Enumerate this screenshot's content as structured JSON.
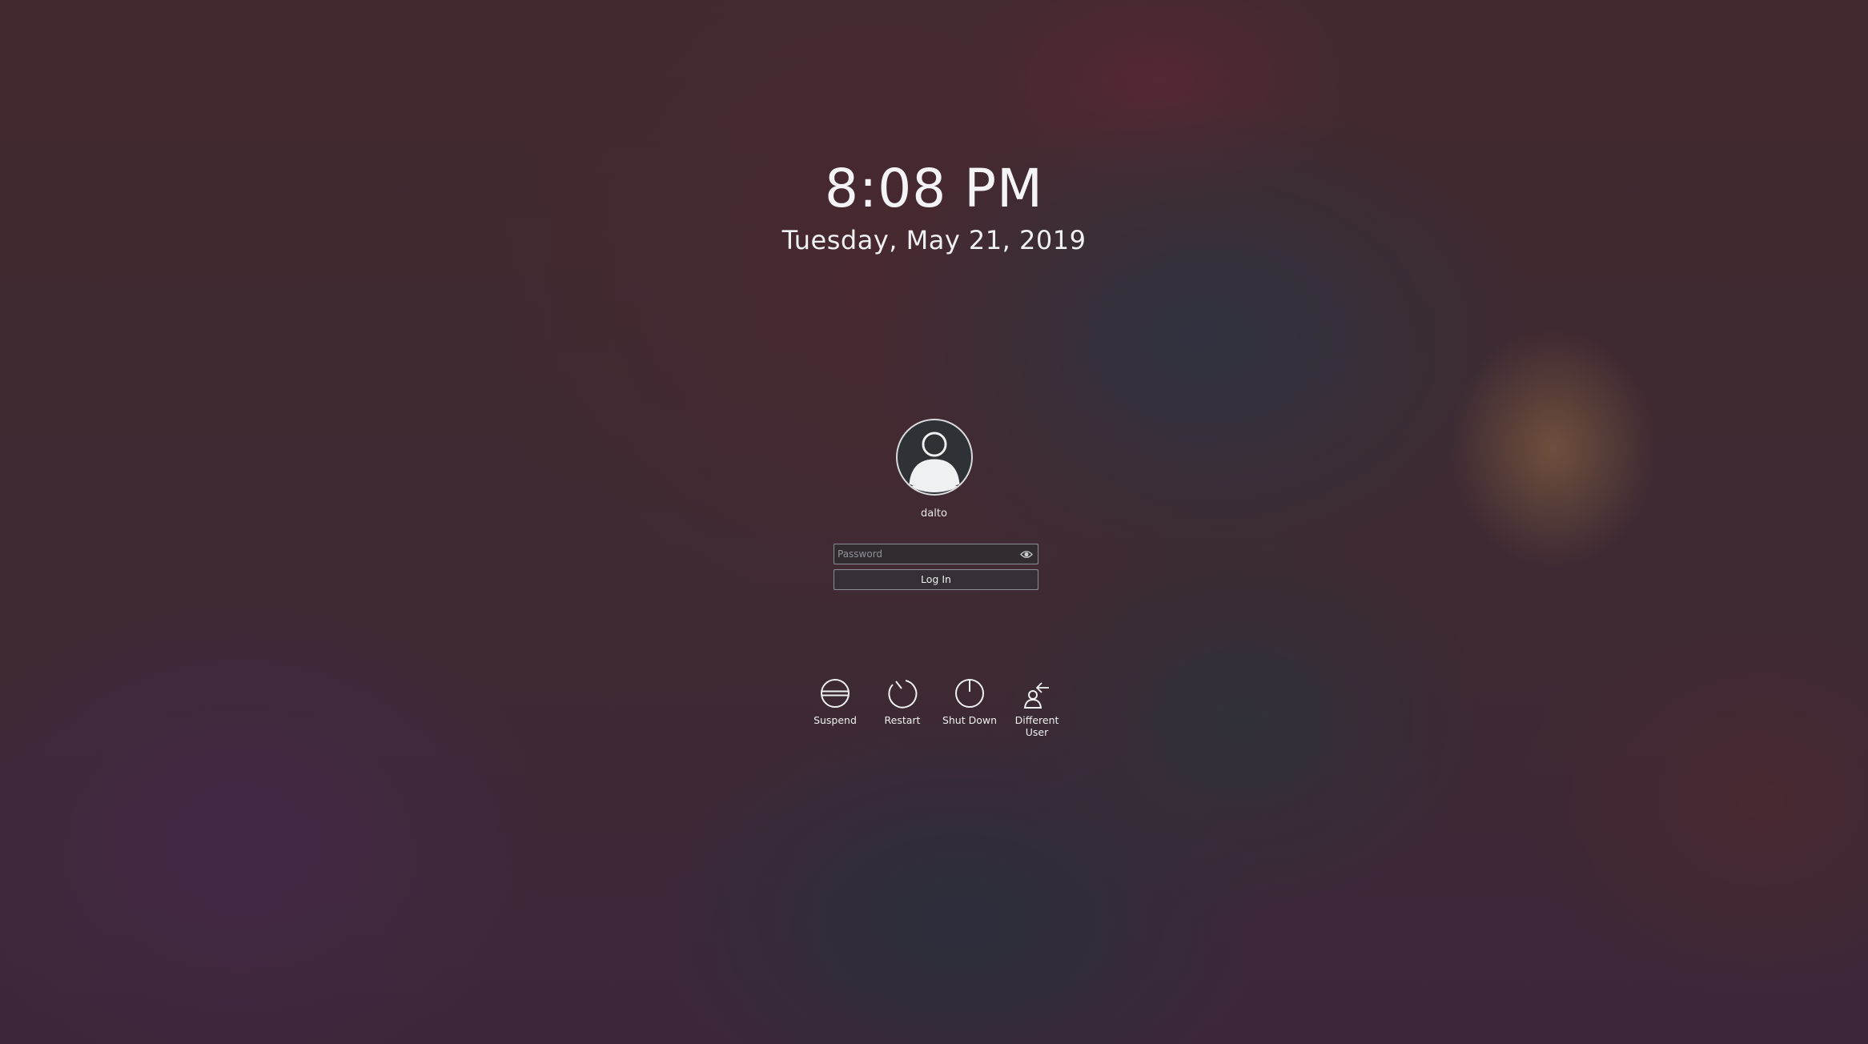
{
  "clock": {
    "time": "8:08 PM",
    "date": "Tuesday, May 21, 2019"
  },
  "user": {
    "name": "dalto",
    "avatar_icon": "user-silhouette-icon"
  },
  "login": {
    "password_placeholder": "Password",
    "password_value": "",
    "reveal_icon": "eye-icon",
    "login_label": "Log In"
  },
  "actions": [
    {
      "label": "Suspend",
      "icon": "suspend-icon"
    },
    {
      "label": "Restart",
      "icon": "restart-icon"
    },
    {
      "label": "Shut Down",
      "icon": "power-icon"
    },
    {
      "label": "Different User",
      "icon": "switch-user-icon"
    }
  ]
}
